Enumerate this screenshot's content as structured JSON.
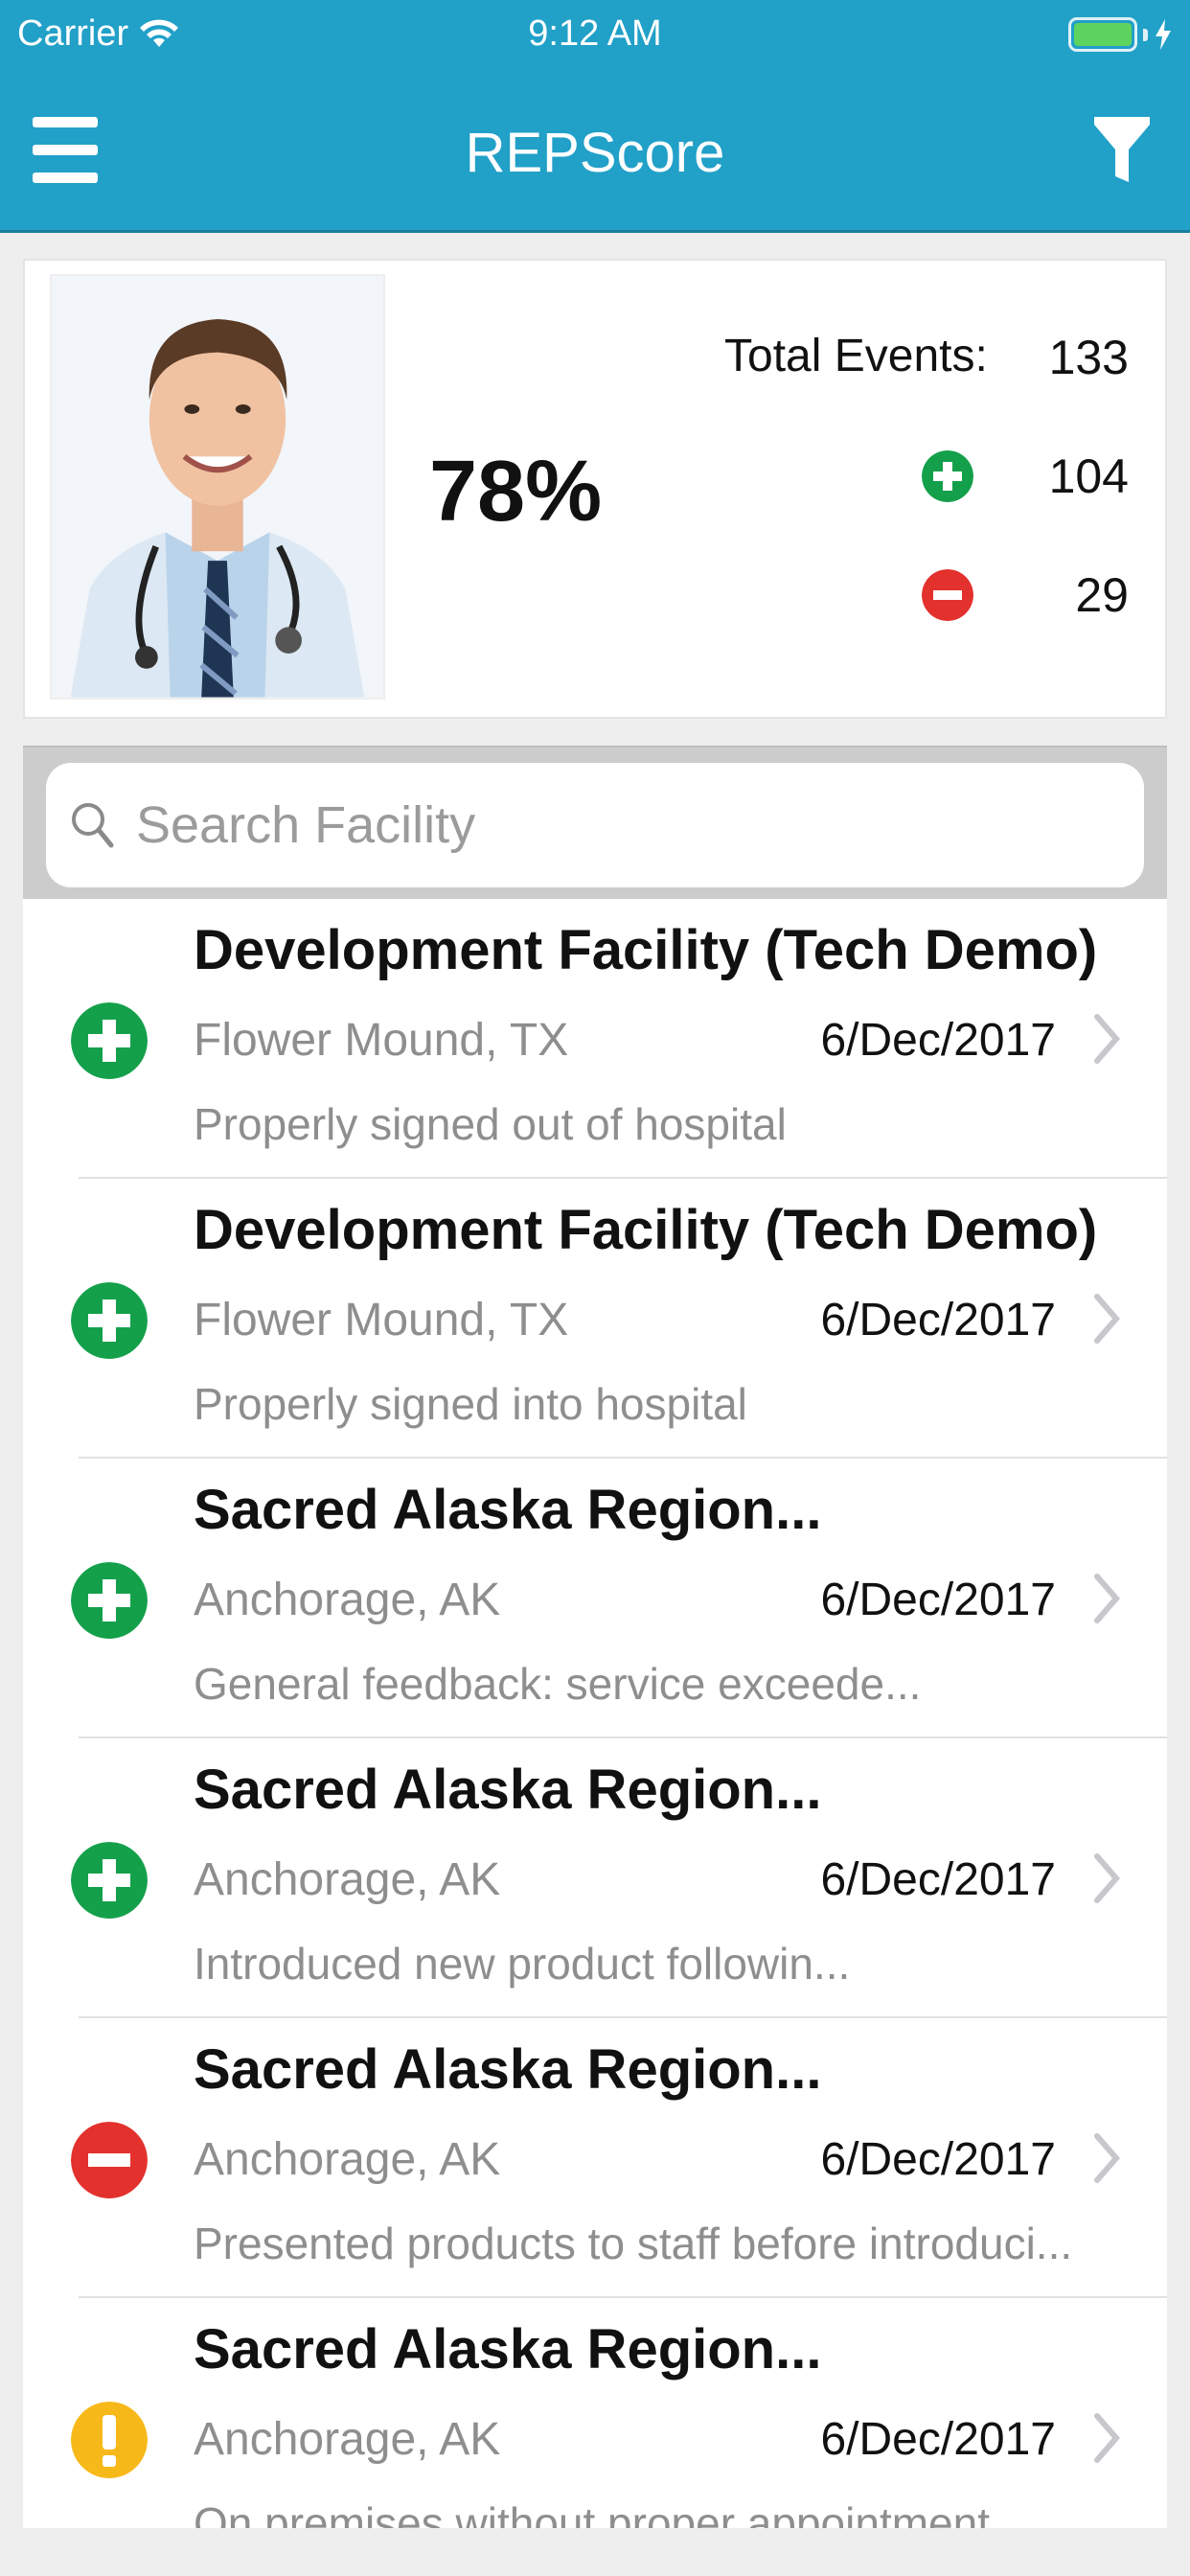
{
  "status_bar": {
    "carrier": "Carrier",
    "time": "9:12 AM"
  },
  "nav": {
    "title": "REPScore",
    "menu_icon": "hamburger-menu-icon",
    "filter_icon": "filter-icon"
  },
  "score": {
    "percent": "78%",
    "total_label": "Total Events:",
    "total_value": "133",
    "positive_value": "104",
    "negative_value": "29"
  },
  "search": {
    "placeholder": "Search Facility",
    "value": ""
  },
  "events": [
    {
      "status": "positive",
      "title": "Development Facility (Tech Demo)",
      "location": "Flower Mound, TX",
      "date": "6/Dec/2017",
      "description": "Properly signed out of hospital"
    },
    {
      "status": "positive",
      "title": "Development Facility (Tech Demo)",
      "location": "Flower Mound, TX",
      "date": "6/Dec/2017",
      "description": "Properly signed into hospital"
    },
    {
      "status": "positive",
      "title": "Sacred Alaska Region...",
      "location": "Anchorage, AK",
      "date": "6/Dec/2017",
      "description": "General feedback: service exceede..."
    },
    {
      "status": "positive",
      "title": "Sacred Alaska Region...",
      "location": "Anchorage, AK",
      "date": "6/Dec/2017",
      "description": "Introduced new product followin..."
    },
    {
      "status": "negative",
      "title": "Sacred Alaska Region...",
      "location": "Anchorage, AK",
      "date": "6/Dec/2017",
      "description": "Presented products to staff before introduci..."
    },
    {
      "status": "warning",
      "title": "Sacred Alaska Region...",
      "location": "Anchorage, AK",
      "date": "6/Dec/2017",
      "description": "On premises without proper appointment"
    }
  ],
  "colors": {
    "header": "#21a0c8",
    "positive": "#14a04b",
    "negative": "#e3312d",
    "warning": "#f7b91a"
  }
}
